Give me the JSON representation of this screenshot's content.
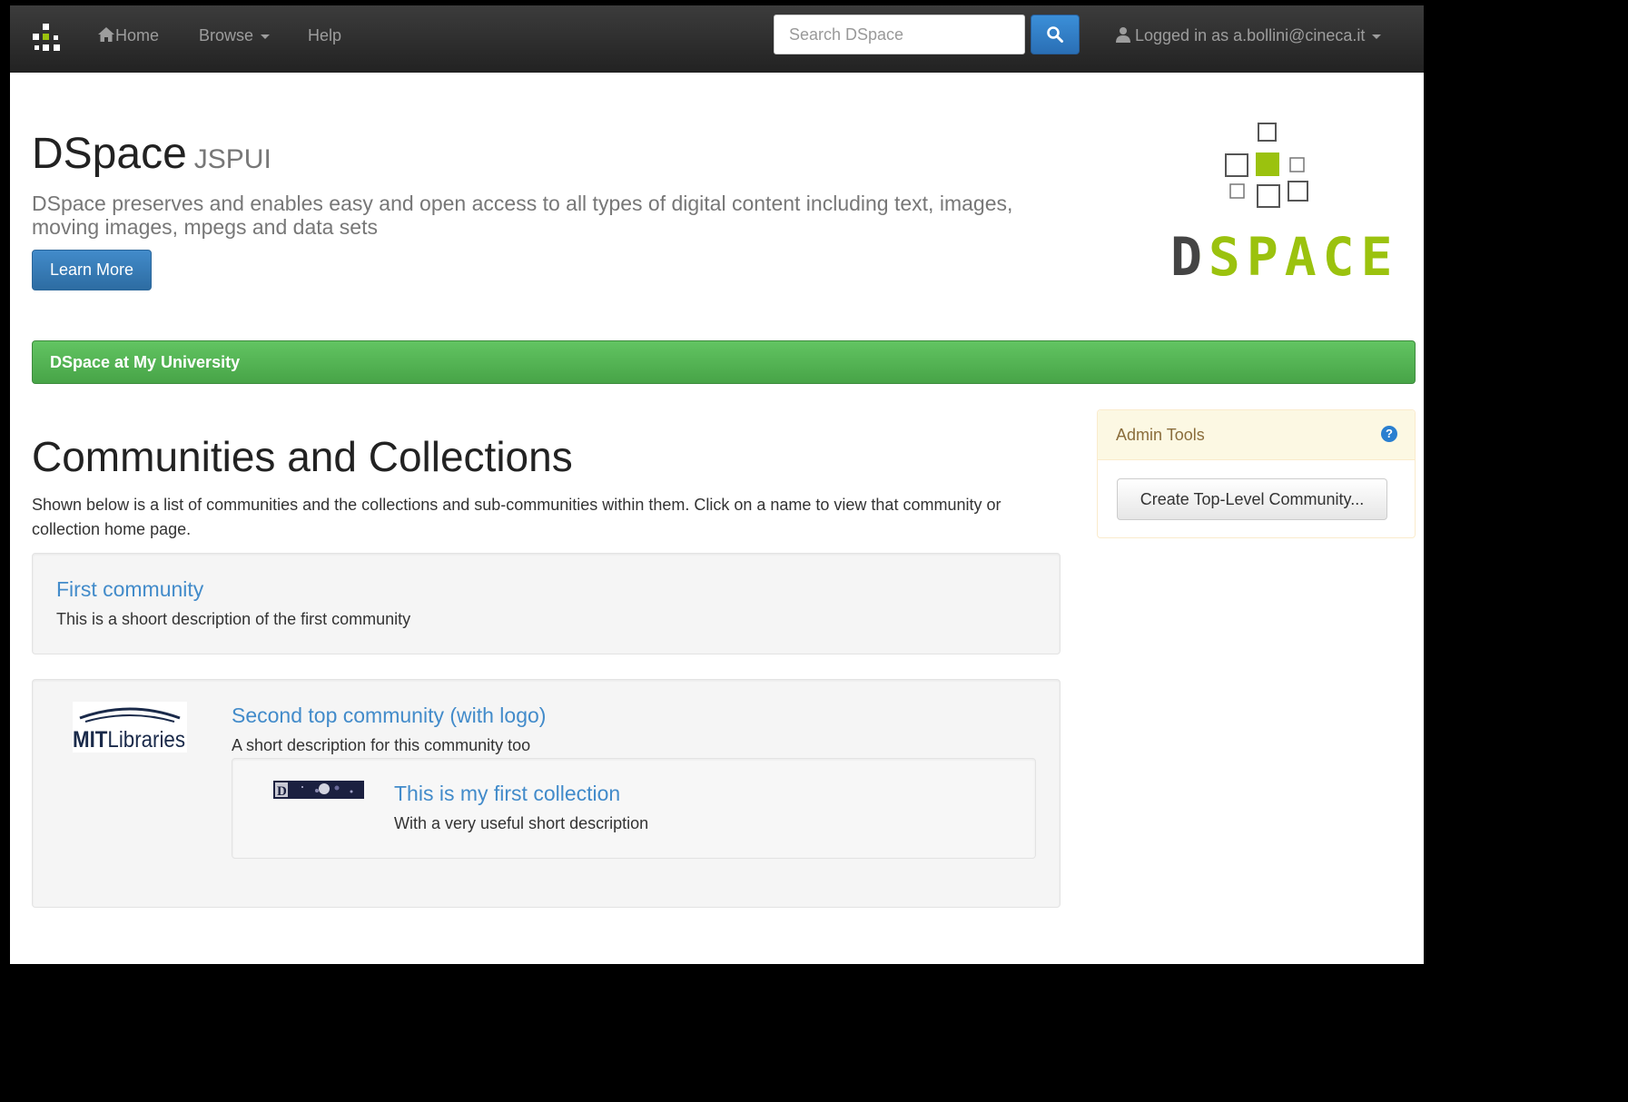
{
  "navbar": {
    "home_label": "Home",
    "browse_label": "Browse",
    "help_label": "Help",
    "search_placeholder": "Search DSpace",
    "user_label": "Logged in as a.bollini@cineca.it"
  },
  "hero": {
    "title": "DSpace",
    "subtitle": "JSPUI",
    "description": "DSpace preserves and enables easy and open access to all types of digital content including text, images, moving images, mpegs and data sets",
    "learn_more_label": "Learn More",
    "logo_text": "DSPACE"
  },
  "site_bar": {
    "title": "DSpace at My University"
  },
  "main": {
    "heading": "Communities and Collections",
    "intro": "Shown below is a list of communities and the collections and sub-communities within them. Click on a name to view that community or collection home page.",
    "communities": [
      {
        "name": "First community",
        "description": "This is a shoort description of the first community"
      },
      {
        "name": "Second top community (with logo)",
        "description": "A short description for this community too",
        "logo_text_bold": "MIT",
        "logo_text": "Libraries",
        "collections": [
          {
            "name": "This is my first collection",
            "description": "With a very useful short description"
          }
        ]
      }
    ]
  },
  "admin": {
    "title": "Admin Tools",
    "help_icon": "?",
    "create_label": "Create Top-Level Community..."
  },
  "colors": {
    "navbar": "#222222",
    "link": "#428bca",
    "primary_button": "#428bca",
    "site_bar": "#5cb85c",
    "logo_green": "#9bc20e",
    "admin_header": "#fcf8e3"
  }
}
